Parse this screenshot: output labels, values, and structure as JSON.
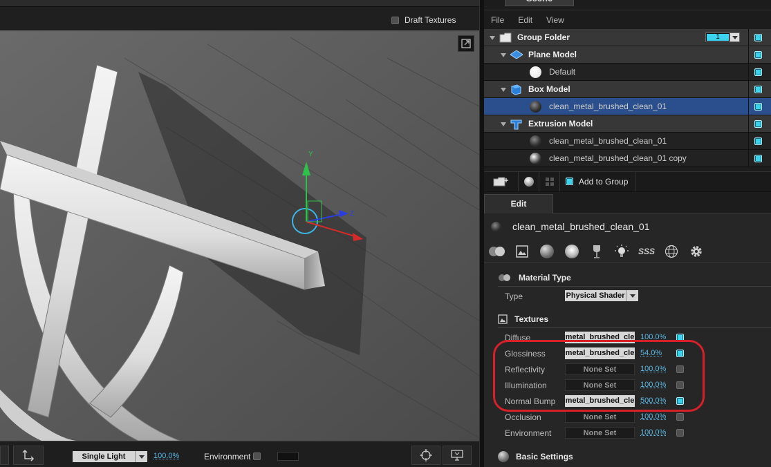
{
  "viewport": {
    "draft_textures_label": "Draft Textures",
    "light_mode": "Single Light",
    "light_intensity": "100.0%",
    "environment_label": "Environment"
  },
  "scene": {
    "tab_label": "Scene",
    "menu": [
      "File",
      "Edit",
      "View"
    ],
    "layer_value": "1",
    "tree": [
      {
        "label": "Group Folder",
        "kind": "group"
      },
      {
        "label": "Plane Model",
        "kind": "group"
      },
      {
        "label": "Default",
        "kind": "child"
      },
      {
        "label": "Box Model",
        "kind": "group"
      },
      {
        "label": "clean_metal_brushed_clean_01",
        "kind": "selected"
      },
      {
        "label": "Extrusion Model",
        "kind": "group"
      },
      {
        "label": "clean_metal_brushed_clean_01",
        "kind": "child"
      },
      {
        "label": "clean_metal_brushed_clean_01 copy",
        "kind": "child"
      }
    ],
    "add_to_group_label": "Add to Group"
  },
  "edit": {
    "tab_label": "Edit",
    "material_name": "clean_metal_brushed_clean_01",
    "material_type_title": "Material Type",
    "type_label": "Type",
    "type_value": "Physical Shader",
    "textures_title": "Textures",
    "textures": [
      {
        "label": "Diffuse",
        "texture": "metal_brushed_cle",
        "value": "100.0%",
        "enabled": true
      },
      {
        "label": "Glossiness",
        "texture": "metal_brushed_cle",
        "value": "54.0%",
        "enabled": true
      },
      {
        "label": "Reflectivity",
        "texture": "None Set",
        "value": "100.0%",
        "enabled": false
      },
      {
        "label": "Illumination",
        "texture": "None Set",
        "value": "100.0%",
        "enabled": false
      },
      {
        "label": "Normal Bump",
        "texture": "metal_brushed_cle",
        "value": "500.0%",
        "enabled": true
      },
      {
        "label": "Occlusion",
        "texture": "None Set",
        "value": "100.0%",
        "enabled": false
      },
      {
        "label": "Environment",
        "texture": "None Set",
        "value": "100.0%",
        "enabled": false
      }
    ],
    "basic_settings_title": "Basic Settings",
    "sss_icon_text": "SSS"
  },
  "colors": {
    "accent": "#3cd3ee",
    "selection": "#2a4f8c",
    "highlight_ring": "#d6202a",
    "link": "#5ab8e6"
  },
  "axis_labels": {
    "x": "X",
    "y": "Y",
    "z": "Z"
  }
}
